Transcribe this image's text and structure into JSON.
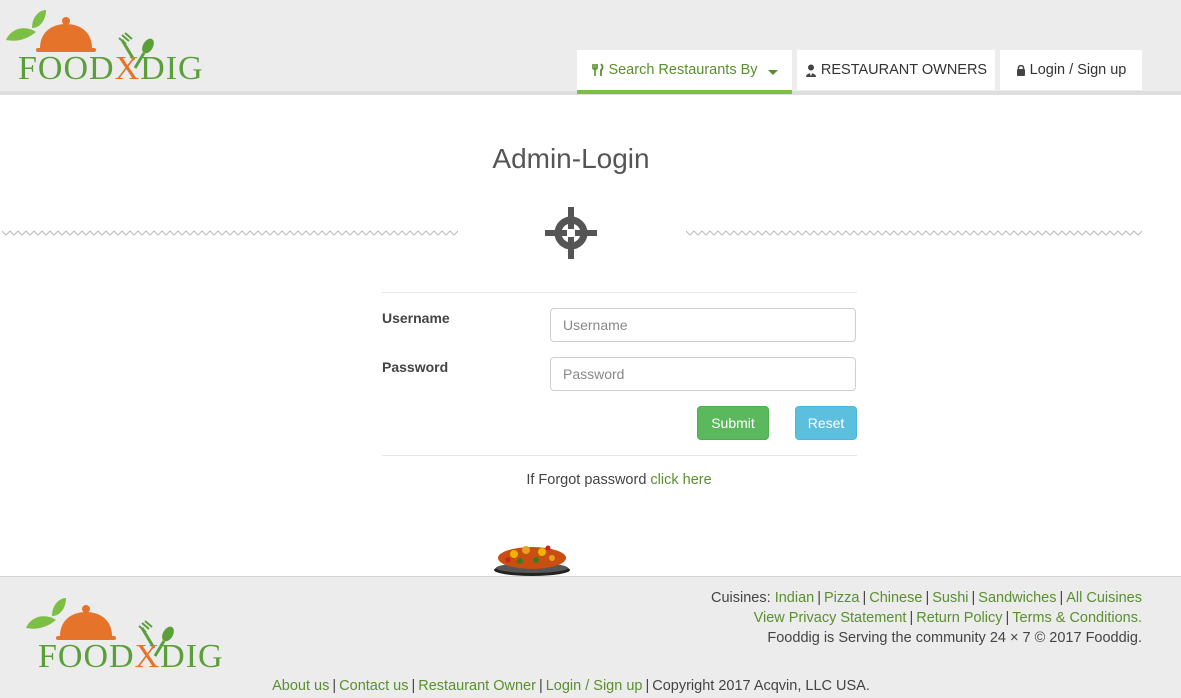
{
  "header": {
    "logo": "FOODXDIG",
    "nav": {
      "search": "Search Restaurants By",
      "owners": "RESTAURANT OWNERS",
      "login": "Login / Sign up"
    }
  },
  "main": {
    "title": "Admin-Login",
    "username_label": "Username",
    "username_placeholder": "Username",
    "password_label": "Password",
    "password_placeholder": "Password",
    "submit_label": "Submit",
    "reset_label": "Reset",
    "forgot_prefix": "If Forgot password",
    "forgot_link": "click here"
  },
  "footer": {
    "cuisines_prefix": "Cuisines:",
    "cuisines": [
      "Indian",
      "Pizza",
      "Chinese",
      "Sushi",
      "Sandwiches",
      "All Cuisines"
    ],
    "policy_links": [
      "View Privacy Statement",
      "Return Policy",
      "Terms & Conditions."
    ],
    "community": "Fooddig is Serving the community 24 × 7 © 2017 Fooddig.",
    "bottom_links": [
      "About us",
      "Contact us",
      "Restaurant Owner",
      "Login / Sign up"
    ],
    "copyright": "Copyright 2017 Acqvin, LLC USA."
  },
  "colors": {
    "brand_green": "#5a9f3a",
    "brand_orange": "#e5732a",
    "submit": "#5cb85c",
    "reset": "#5bc0de"
  },
  "icons": [
    "fork-knife-icon",
    "user-tie-icon",
    "lock-icon",
    "crosshair-icon",
    "food-dish-icon"
  ]
}
